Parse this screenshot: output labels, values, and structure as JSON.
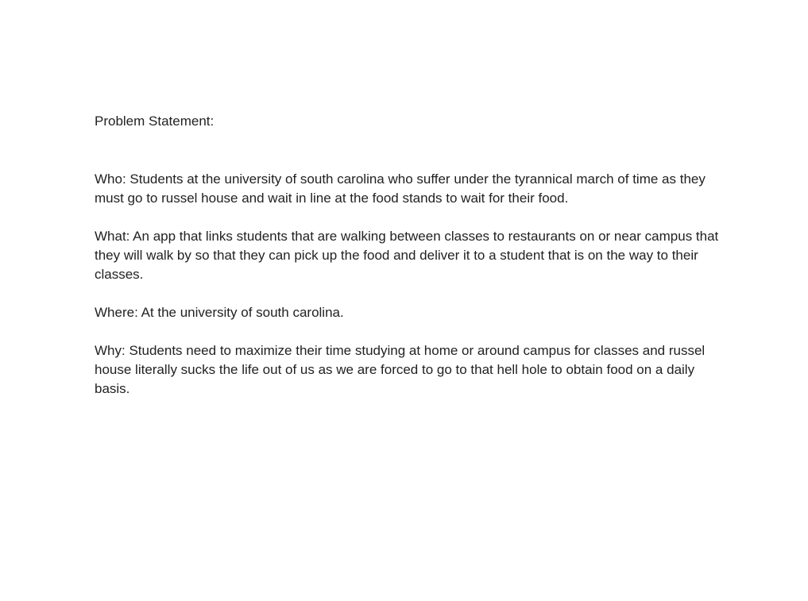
{
  "document": {
    "title": "Problem Statement:",
    "sections": [
      {
        "text": "Who: Students at the university of south carolina who suffer under the tyrannical march of time as they must go to russel house and wait in line at the food stands to wait for their food."
      },
      {
        "text": "What: An app that links students that are walking between classes to restaurants on or near campus that they will walk by so that they can pick up the food and deliver it to a student that is on the way to their classes."
      },
      {
        "text": "Where: At the university of south carolina."
      },
      {
        "text": "Why: Students need to maximize their time studying at home or around campus for classes and russel house literally sucks the life out of us as we are forced to go to that hell hole to obtain food on a daily basis."
      }
    ]
  }
}
